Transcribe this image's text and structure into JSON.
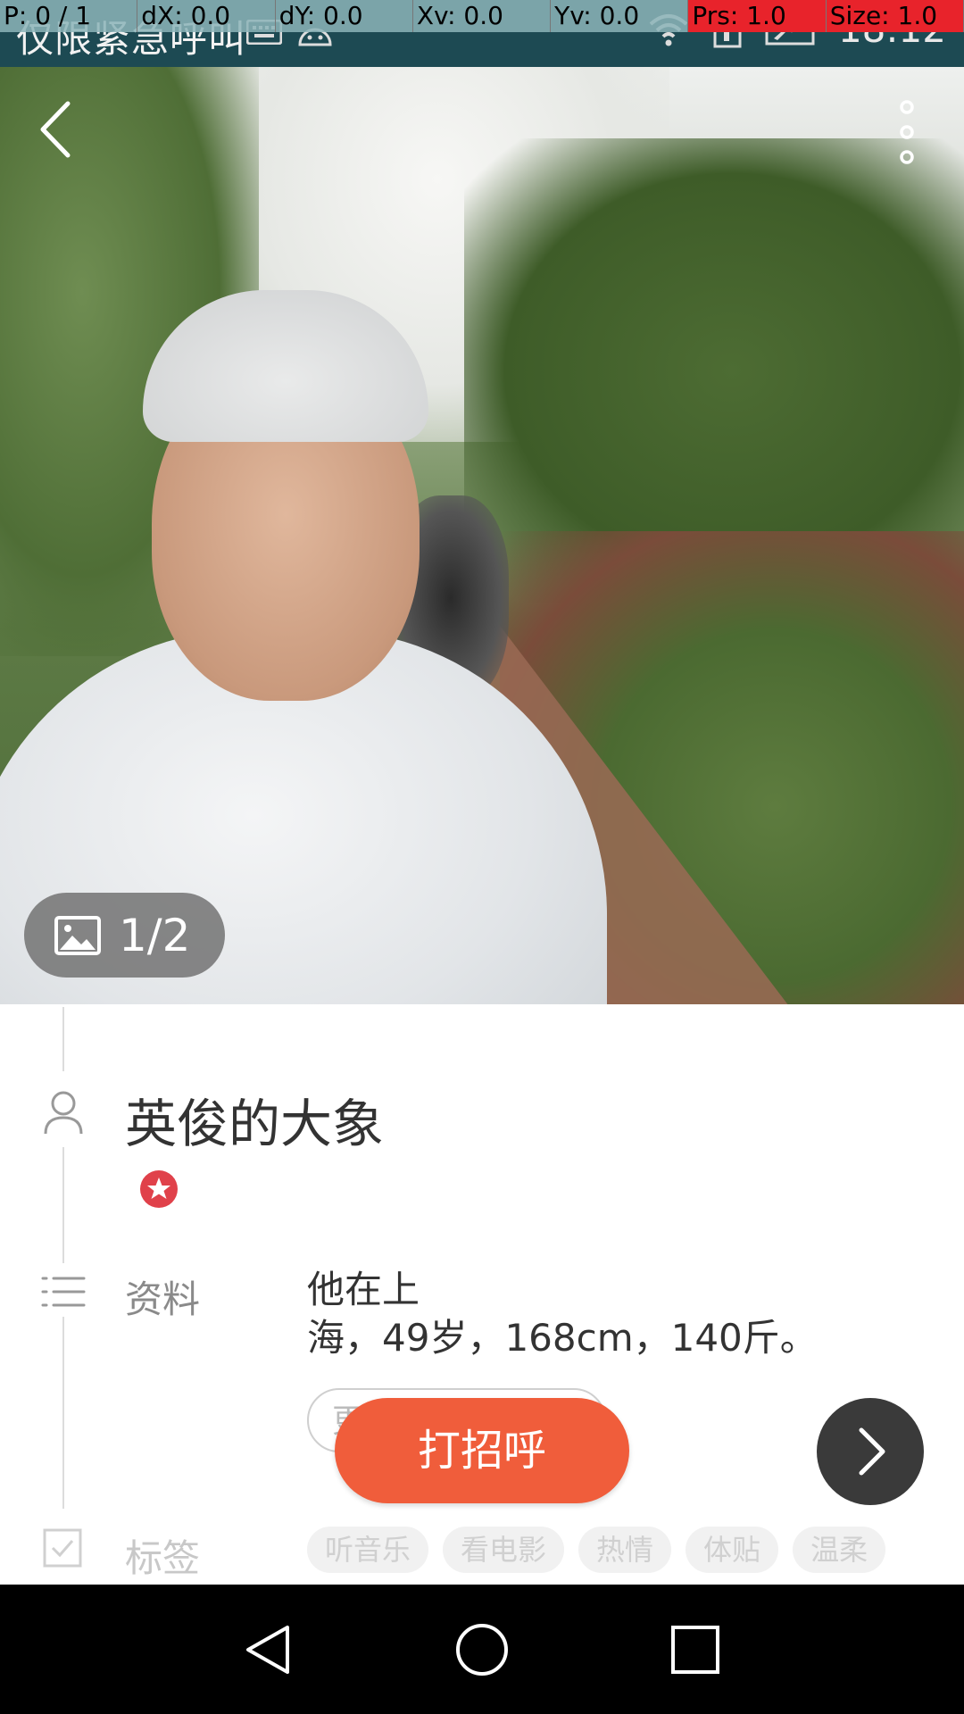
{
  "status_bar": {
    "carrier": "仅限紧急呼叫",
    "time": "18:12"
  },
  "debug_overlay": {
    "p": "P: 0 / 1",
    "dx": "dX: 0.0",
    "dy": "dY: 0.0",
    "xv": "Xv: 0.0",
    "yv": "Yv: 0.0",
    "prs": "Prs: 1.0",
    "size": "Size: 1.0"
  },
  "photo": {
    "counter": "1/2"
  },
  "profile": {
    "name": "英俊的大象",
    "info_label": "资料",
    "info_text": "他在上\n海，49岁，168cm，140斤。",
    "hidden_chip_text": "更",
    "tags_label": "标签",
    "tags": [
      "听音乐",
      "看电影",
      "热情",
      "体贴",
      "温柔"
    ]
  },
  "actions": {
    "greet_label": "打招呼"
  },
  "colors": {
    "accent": "#f05d3b",
    "statusbar": "#1d4a53",
    "debug_red": "#e8232b",
    "vip_badge": "#e0414a"
  },
  "icons": {
    "back": "back-arrow-icon",
    "more": "more-vertical-icon",
    "photo": "image-icon",
    "person": "person-icon",
    "list": "list-icon",
    "tag": "checkbox-icon",
    "next": "chevron-right-icon"
  }
}
